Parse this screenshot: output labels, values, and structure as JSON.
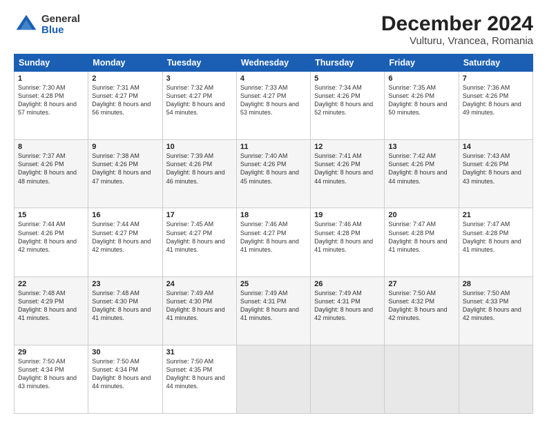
{
  "header": {
    "logo_general": "General",
    "logo_blue": "Blue",
    "title": "December 2024",
    "subtitle": "Vulturu, Vrancea, Romania"
  },
  "weekdays": [
    "Sunday",
    "Monday",
    "Tuesday",
    "Wednesday",
    "Thursday",
    "Friday",
    "Saturday"
  ],
  "weeks": [
    [
      {
        "day": "1",
        "sunrise": "Sunrise: 7:30 AM",
        "sunset": "Sunset: 4:28 PM",
        "daylight": "Daylight: 8 hours and 57 minutes."
      },
      {
        "day": "2",
        "sunrise": "Sunrise: 7:31 AM",
        "sunset": "Sunset: 4:27 PM",
        "daylight": "Daylight: 8 hours and 56 minutes."
      },
      {
        "day": "3",
        "sunrise": "Sunrise: 7:32 AM",
        "sunset": "Sunset: 4:27 PM",
        "daylight": "Daylight: 8 hours and 54 minutes."
      },
      {
        "day": "4",
        "sunrise": "Sunrise: 7:33 AM",
        "sunset": "Sunset: 4:27 PM",
        "daylight": "Daylight: 8 hours and 53 minutes."
      },
      {
        "day": "5",
        "sunrise": "Sunrise: 7:34 AM",
        "sunset": "Sunset: 4:26 PM",
        "daylight": "Daylight: 8 hours and 52 minutes."
      },
      {
        "day": "6",
        "sunrise": "Sunrise: 7:35 AM",
        "sunset": "Sunset: 4:26 PM",
        "daylight": "Daylight: 8 hours and 50 minutes."
      },
      {
        "day": "7",
        "sunrise": "Sunrise: 7:36 AM",
        "sunset": "Sunset: 4:26 PM",
        "daylight": "Daylight: 8 hours and 49 minutes."
      }
    ],
    [
      {
        "day": "8",
        "sunrise": "Sunrise: 7:37 AM",
        "sunset": "Sunset: 4:26 PM",
        "daylight": "Daylight: 8 hours and 48 minutes."
      },
      {
        "day": "9",
        "sunrise": "Sunrise: 7:38 AM",
        "sunset": "Sunset: 4:26 PM",
        "daylight": "Daylight: 8 hours and 47 minutes."
      },
      {
        "day": "10",
        "sunrise": "Sunrise: 7:39 AM",
        "sunset": "Sunset: 4:26 PM",
        "daylight": "Daylight: 8 hours and 46 minutes."
      },
      {
        "day": "11",
        "sunrise": "Sunrise: 7:40 AM",
        "sunset": "Sunset: 4:26 PM",
        "daylight": "Daylight: 8 hours and 45 minutes."
      },
      {
        "day": "12",
        "sunrise": "Sunrise: 7:41 AM",
        "sunset": "Sunset: 4:26 PM",
        "daylight": "Daylight: 8 hours and 44 minutes."
      },
      {
        "day": "13",
        "sunrise": "Sunrise: 7:42 AM",
        "sunset": "Sunset: 4:26 PM",
        "daylight": "Daylight: 8 hours and 44 minutes."
      },
      {
        "day": "14",
        "sunrise": "Sunrise: 7:43 AM",
        "sunset": "Sunset: 4:26 PM",
        "daylight": "Daylight: 8 hours and 43 minutes."
      }
    ],
    [
      {
        "day": "15",
        "sunrise": "Sunrise: 7:44 AM",
        "sunset": "Sunset: 4:26 PM",
        "daylight": "Daylight: 8 hours and 42 minutes."
      },
      {
        "day": "16",
        "sunrise": "Sunrise: 7:44 AM",
        "sunset": "Sunset: 4:27 PM",
        "daylight": "Daylight: 8 hours and 42 minutes."
      },
      {
        "day": "17",
        "sunrise": "Sunrise: 7:45 AM",
        "sunset": "Sunset: 4:27 PM",
        "daylight": "Daylight: 8 hours and 41 minutes."
      },
      {
        "day": "18",
        "sunrise": "Sunrise: 7:46 AM",
        "sunset": "Sunset: 4:27 PM",
        "daylight": "Daylight: 8 hours and 41 minutes."
      },
      {
        "day": "19",
        "sunrise": "Sunrise: 7:46 AM",
        "sunset": "Sunset: 4:28 PM",
        "daylight": "Daylight: 8 hours and 41 minutes."
      },
      {
        "day": "20",
        "sunrise": "Sunrise: 7:47 AM",
        "sunset": "Sunset: 4:28 PM",
        "daylight": "Daylight: 8 hours and 41 minutes."
      },
      {
        "day": "21",
        "sunrise": "Sunrise: 7:47 AM",
        "sunset": "Sunset: 4:28 PM",
        "daylight": "Daylight: 8 hours and 41 minutes."
      }
    ],
    [
      {
        "day": "22",
        "sunrise": "Sunrise: 7:48 AM",
        "sunset": "Sunset: 4:29 PM",
        "daylight": "Daylight: 8 hours and 41 minutes."
      },
      {
        "day": "23",
        "sunrise": "Sunrise: 7:48 AM",
        "sunset": "Sunset: 4:30 PM",
        "daylight": "Daylight: 8 hours and 41 minutes."
      },
      {
        "day": "24",
        "sunrise": "Sunrise: 7:49 AM",
        "sunset": "Sunset: 4:30 PM",
        "daylight": "Daylight: 8 hours and 41 minutes."
      },
      {
        "day": "25",
        "sunrise": "Sunrise: 7:49 AM",
        "sunset": "Sunset: 4:31 PM",
        "daylight": "Daylight: 8 hours and 41 minutes."
      },
      {
        "day": "26",
        "sunrise": "Sunrise: 7:49 AM",
        "sunset": "Sunset: 4:31 PM",
        "daylight": "Daylight: 8 hours and 42 minutes."
      },
      {
        "day": "27",
        "sunrise": "Sunrise: 7:50 AM",
        "sunset": "Sunset: 4:32 PM",
        "daylight": "Daylight: 8 hours and 42 minutes."
      },
      {
        "day": "28",
        "sunrise": "Sunrise: 7:50 AM",
        "sunset": "Sunset: 4:33 PM",
        "daylight": "Daylight: 8 hours and 42 minutes."
      }
    ],
    [
      {
        "day": "29",
        "sunrise": "Sunrise: 7:50 AM",
        "sunset": "Sunset: 4:34 PM",
        "daylight": "Daylight: 8 hours and 43 minutes."
      },
      {
        "day": "30",
        "sunrise": "Sunrise: 7:50 AM",
        "sunset": "Sunset: 4:34 PM",
        "daylight": "Daylight: 8 hours and 44 minutes."
      },
      {
        "day": "31",
        "sunrise": "Sunrise: 7:50 AM",
        "sunset": "Sunset: 4:35 PM",
        "daylight": "Daylight: 8 hours and 44 minutes."
      },
      null,
      null,
      null,
      null
    ]
  ]
}
